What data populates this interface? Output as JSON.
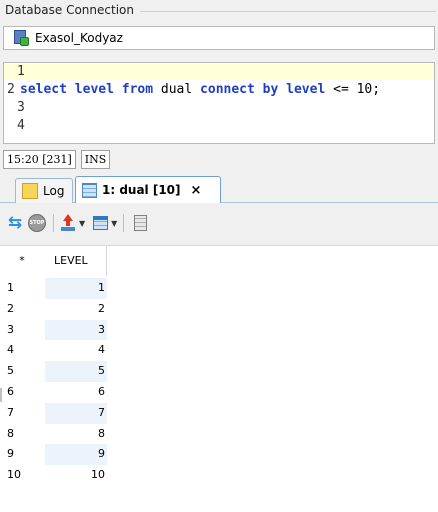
{
  "db_connection": {
    "group_title": "Database Connection",
    "selected": "Exasol_Kodyaz"
  },
  "editor": {
    "line_numbers": [
      "1",
      "2",
      "3",
      "4"
    ],
    "tokens": {
      "select": "select",
      "level1": "level",
      "from": "from",
      "dual": "dual",
      "connect": "connect",
      "by": "by",
      "level2": "level",
      "op": "<=",
      "ten": "10;"
    }
  },
  "status": {
    "position": "15:20 [231]",
    "mode": "INS"
  },
  "tabs": {
    "log_label": "Log",
    "result_label": "1: dual [10]",
    "close_glyph": "×"
  },
  "toolbar": {
    "stop_text": "STOP"
  },
  "grid": {
    "corner": "*",
    "column_header": "LEVEL",
    "rows": [
      {
        "num": "1",
        "value": "1"
      },
      {
        "num": "2",
        "value": "2"
      },
      {
        "num": "3",
        "value": "3"
      },
      {
        "num": "4",
        "value": "4"
      },
      {
        "num": "5",
        "value": "5"
      },
      {
        "num": "6",
        "value": "6"
      },
      {
        "num": "7",
        "value": "7"
      },
      {
        "num": "8",
        "value": "8"
      },
      {
        "num": "9",
        "value": "9"
      },
      {
        "num": "10",
        "value": "10"
      }
    ]
  },
  "colors": {
    "keyword": "#1f3fbf",
    "current_line": "#ffffd8",
    "tab_border": "#6f9fd0",
    "alt_row": "#edf3fb"
  }
}
